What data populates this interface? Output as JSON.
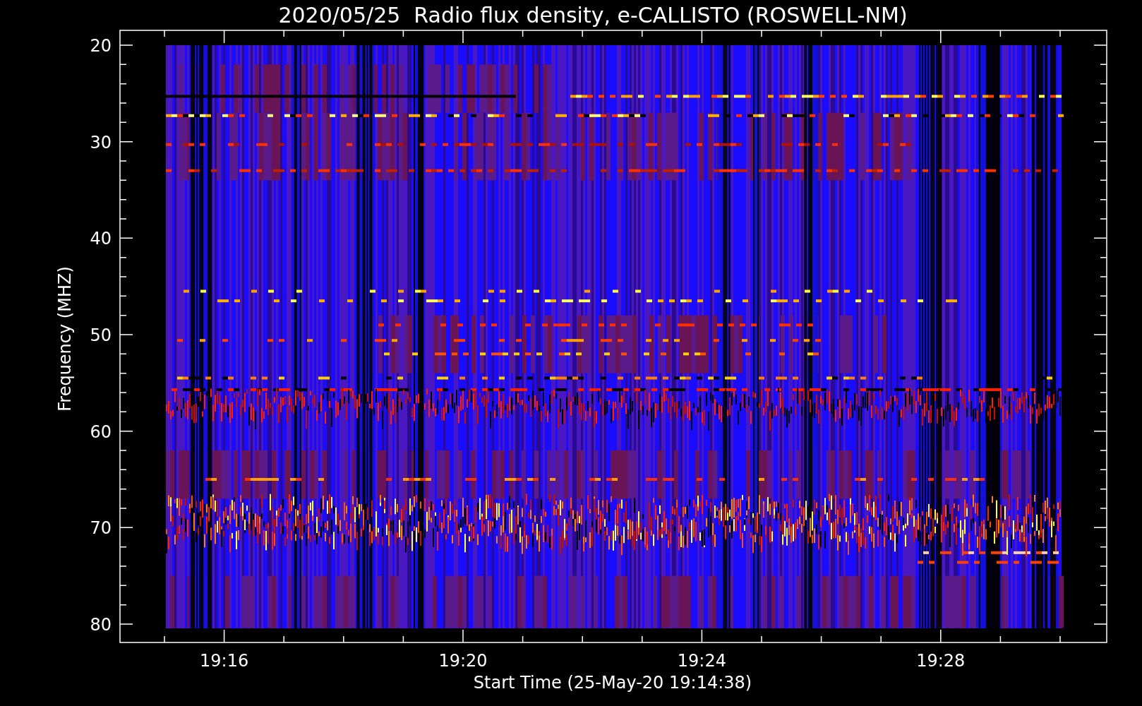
{
  "title": "2020/05/25  Radio flux density, e-CALLISTO (ROSWELL-NM)",
  "y_axis": {
    "label": "Frequency (MHZ)",
    "ticks": [
      "20",
      "30",
      "40",
      "50",
      "60",
      "70",
      "80"
    ]
  },
  "x_axis": {
    "label": "Start Time (25-May-20 19:14:38)",
    "ticks": [
      "19:16",
      "19:20",
      "19:24",
      "19:28"
    ]
  }
}
